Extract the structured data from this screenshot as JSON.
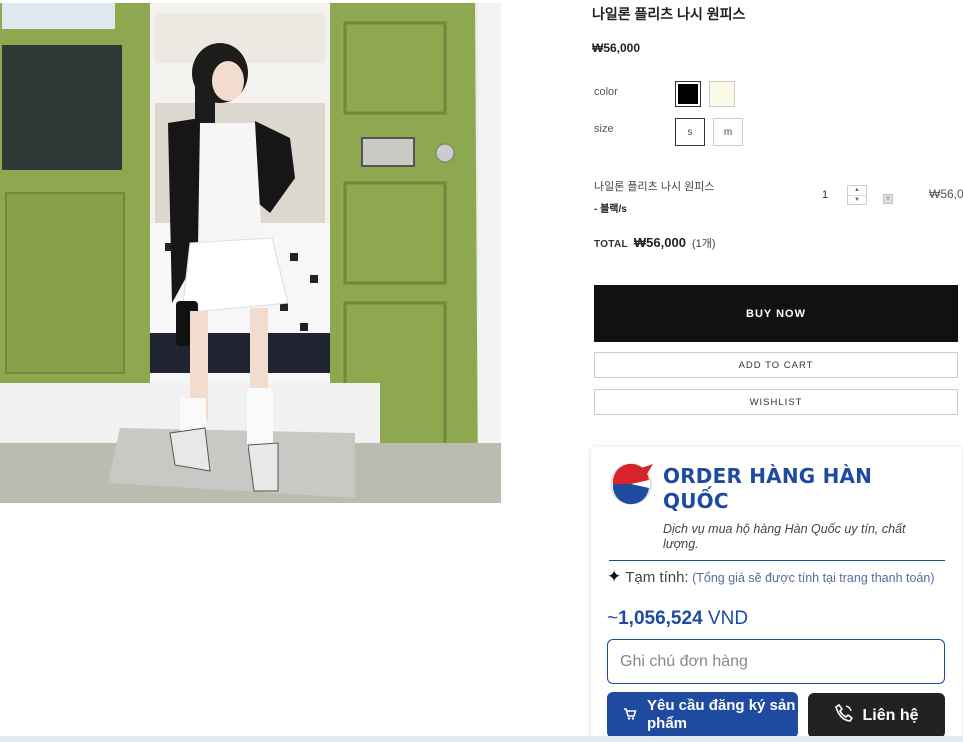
{
  "product": {
    "title": "나일론 플리츠 나시 원피스",
    "price": "₩56,000",
    "color_label": "color",
    "size_label": "size",
    "colors": [
      {
        "name": "black",
        "hex": "#000000",
        "selected": true
      },
      {
        "name": "cream",
        "hex": "#fbfbe8",
        "selected": false
      }
    ],
    "sizes": [
      {
        "label": "s",
        "selected": true
      },
      {
        "label": "m",
        "selected": false
      }
    ]
  },
  "selection": {
    "name": "나일론 플리츠 나시 원피스",
    "option": "- 블랙/s",
    "quantity": "1",
    "line_price": "₩56,0"
  },
  "total": {
    "label": "TOTAL",
    "amount": "₩56,000",
    "count": "(1개)"
  },
  "actions": {
    "buy_now": "BUY NOW",
    "add_to_cart": "ADD TO CART",
    "wishlist": "WISHLIST"
  },
  "order_widget": {
    "title": "ORDER HÀNG HÀN QUỐC",
    "description": "Dịch vụ mua hộ hàng Hàn Quốc uy tín, chất lượng.",
    "estimate_title": "Tạm tính:",
    "estimate_note": "(Tổng giá sẽ được tính tại trang thanh toán)",
    "amount_prefix": "~",
    "amount_value": "1,056,524",
    "amount_currency": "VND",
    "note_placeholder": "Ghi chú đơn hàng",
    "request_button": "Yêu cầu đăng ký sản phẩm",
    "contact_button": "Liên hệ",
    "brand_color": "#1e4aa0"
  }
}
